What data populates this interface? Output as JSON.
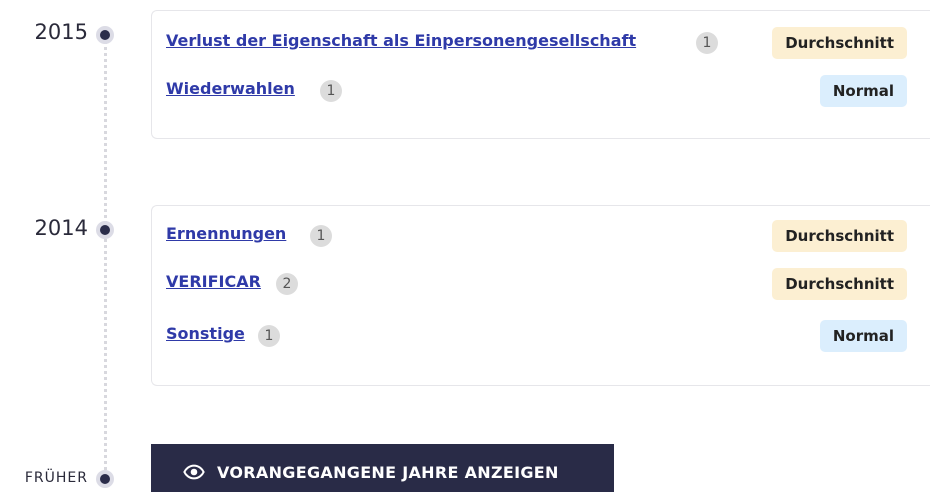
{
  "timeline": {
    "years": [
      {
        "year": "2015",
        "items": [
          {
            "label": "Verlust der Eigenschaft als Einpersonengesellschaft",
            "count": "1",
            "badge": "Durchschnitt",
            "badge_color": "#fcefd2"
          },
          {
            "label": "Wiederwahlen",
            "count": "1",
            "badge": "Normal",
            "badge_color": "#dbeefd"
          }
        ]
      },
      {
        "year": "2014",
        "items": [
          {
            "label": "Ernennungen",
            "count": "1",
            "badge": "Durchschnitt",
            "badge_color": "#fcefd2"
          },
          {
            "label": "VERIFICAR",
            "count": "2",
            "badge": "Durchschnitt",
            "badge_color": "#fcefd2"
          },
          {
            "label": "Sonstige",
            "count": "1",
            "badge": "Normal",
            "badge_color": "#dbeefd"
          }
        ]
      }
    ],
    "earlier_label": "FRÜHER",
    "show_previous_button": {
      "label": "VORANGEGANGENE JAHRE ANZEIGEN",
      "icon": "eye-icon"
    }
  },
  "colors": {
    "link": "#2f3aa8",
    "dot": "#2b2d4a",
    "button_bg": "#292b47"
  }
}
